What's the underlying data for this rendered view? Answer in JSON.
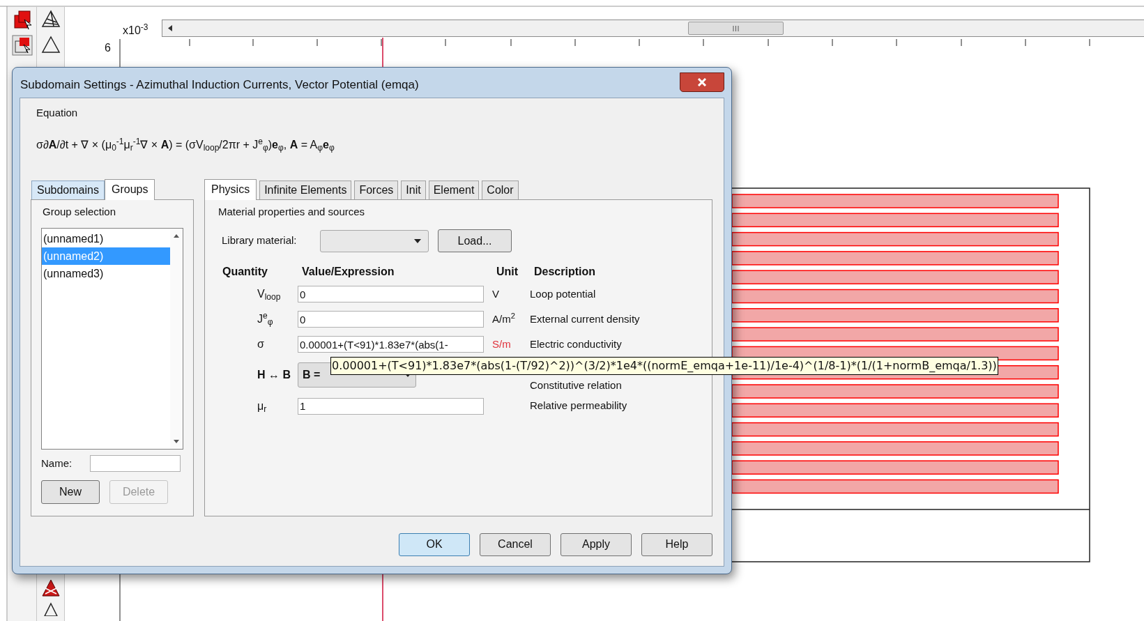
{
  "ruler": {
    "exponent_label": "x10$^{-3}$",
    "tick_label": "6"
  },
  "dialog": {
    "title": "Subdomain Settings - Azimuthal Induction Currents, Vector Potential (emqa)",
    "equation": {
      "label": "Equation",
      "formula": "σ∂**A**/∂t + ∇ × (μ$_{0}$$^{-1}$μ$_{r}$$^{-1}$∇ × **A**) = (σV$_{loop}$/2πr + J$^{e}$$_{φ}$)**e**$_{φ}$, **A** = A$_{φ}$**e**$_{φ}$"
    },
    "left_tabs": [
      {
        "label": "Subdomains",
        "selected": false
      },
      {
        "label": "Groups",
        "selected": true
      }
    ],
    "group_selection": {
      "label": "Group selection",
      "items": [
        {
          "label": "(unnamed1)",
          "selected": false
        },
        {
          "label": "(unnamed2)",
          "selected": true
        },
        {
          "label": "(unnamed3)",
          "selected": false
        }
      ]
    },
    "name_field": {
      "label": "Name:"
    },
    "group_buttons": [
      {
        "label": "New",
        "disabled": false
      },
      {
        "label": "Delete",
        "disabled": true
      }
    ],
    "tabs": [
      {
        "label": "Physics",
        "selected": true
      },
      {
        "label": "Infinite Elements",
        "selected": false
      },
      {
        "label": "Forces",
        "selected": false
      },
      {
        "label": "Init",
        "selected": false
      },
      {
        "label": "Element",
        "selected": false
      },
      {
        "label": "Color",
        "selected": false
      }
    ],
    "section_title": "Material properties and sources",
    "library_material": {
      "label": "Library material:",
      "button": "Load..."
    },
    "table": {
      "columns": [
        "Quantity",
        "Value/Expression",
        "Unit",
        "Description"
      ],
      "rows": [
        {
          "kind": "field",
          "quantity": "V$_{loop}$",
          "value": "0",
          "unit": "V",
          "unit_warning": false,
          "description": "Loop potential"
        },
        {
          "kind": "field",
          "quantity": "J$^{e}$$_{φ}$",
          "value": "0",
          "unit": "A/m$^{2}$",
          "unit_warning": false,
          "description": "External current density"
        },
        {
          "kind": "field",
          "quantity": "σ",
          "value": "0.00001+(T<91)*1.83e7*(abs(1-",
          "unit": "S/m",
          "unit_warning": true,
          "description": "Electric conductivity"
        },
        {
          "kind": "select",
          "quantity": "H ↔ B",
          "value": "B =",
          "description": "Constitutive relation"
        },
        {
          "kind": "field",
          "quantity": "μ$_{r}$",
          "value": "1",
          "description": "Relative permeability"
        }
      ]
    },
    "buttons": [
      {
        "label": "OK",
        "default": true
      },
      {
        "label": "Cancel",
        "default": false
      },
      {
        "label": "Apply",
        "default": false
      },
      {
        "label": "Help",
        "default": false
      }
    ]
  },
  "tooltip": "0.00001+(T<91)*1.83e7*(abs(1-(T/92)^2))^(3/2)*1e4*((normE_emqa+1e-11)/1e-4)^(1/8-1)*(1/(1+normB_emqa/1.3))"
}
